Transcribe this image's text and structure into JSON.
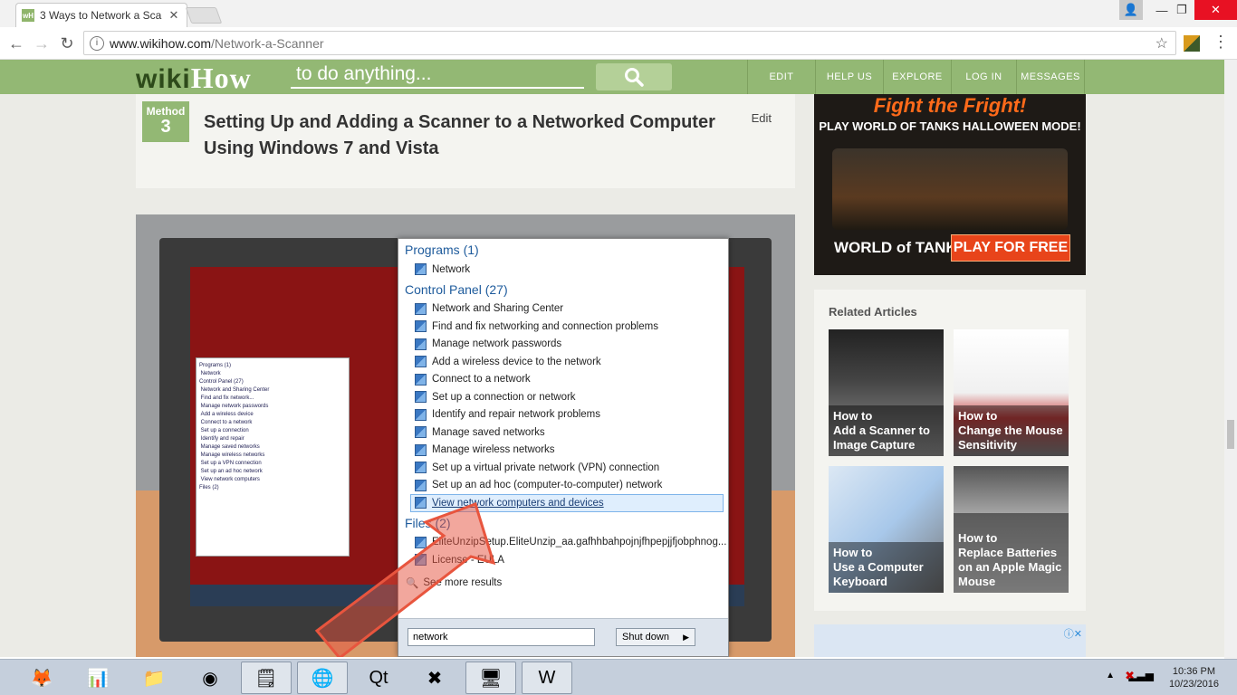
{
  "browser": {
    "tab_title": "3 Ways to Network a Sca",
    "url_host": "www.wikihow.com",
    "url_path": "/Network-a-Scanner"
  },
  "wikihow": {
    "logo_wiki": "wiki",
    "logo_how": "How",
    "search_placeholder": "to do anything...",
    "nav": [
      "EDIT",
      "HELP US",
      "EXPLORE",
      "LOG IN",
      "MESSAGES"
    ]
  },
  "method": {
    "label": "Method",
    "number": "3",
    "title": "Setting Up and Adding a Scanner to a Networked Computer Using Windows 7 and Vista",
    "edit": "Edit"
  },
  "startmenu": {
    "programs_header": "Programs (1)",
    "programs": [
      "Network"
    ],
    "control_header": "Control Panel (27)",
    "control_items": [
      "Network and Sharing Center",
      "Find and fix networking and connection problems",
      "Manage network passwords",
      "Add a wireless device to the network",
      "Connect to a network",
      "Set up a connection or network",
      "Identify and repair network problems",
      "Manage saved networks",
      "Manage wireless networks",
      "Set up a virtual private network (VPN) connection",
      "Set up an ad hoc (computer-to-computer) network",
      "View network computers and devices"
    ],
    "files_header": "Files (2)",
    "files": [
      "EliteUnzipSetup.EliteUnzip_aa.gafhhbahpojnjfhpepjjfjobphnog...",
      "License - EULA"
    ],
    "see_more": "See more results",
    "search_value": "network",
    "shutdown": "Shut down"
  },
  "ad": {
    "headline": "Fight the Fright!",
    "subline": "PLAY WORLD OF TANKS HALLOWEEN MODE!",
    "brand": "WORLD of TANKS",
    "cta": "PLAY FOR FREE"
  },
  "related": {
    "title": "Related Articles",
    "items": [
      {
        "prefix": "How to",
        "title": "Add a Scanner to Image Capture"
      },
      {
        "prefix": "How to",
        "title": "Change the Mouse Sensitivity"
      },
      {
        "prefix": "How to",
        "title": "Use a Computer Keyboard"
      },
      {
        "prefix": "How to",
        "title": "Replace Batteries on an Apple Magic Mouse"
      }
    ]
  },
  "taskbar": {
    "time": "10:36 PM",
    "date": "10/23/2016"
  }
}
